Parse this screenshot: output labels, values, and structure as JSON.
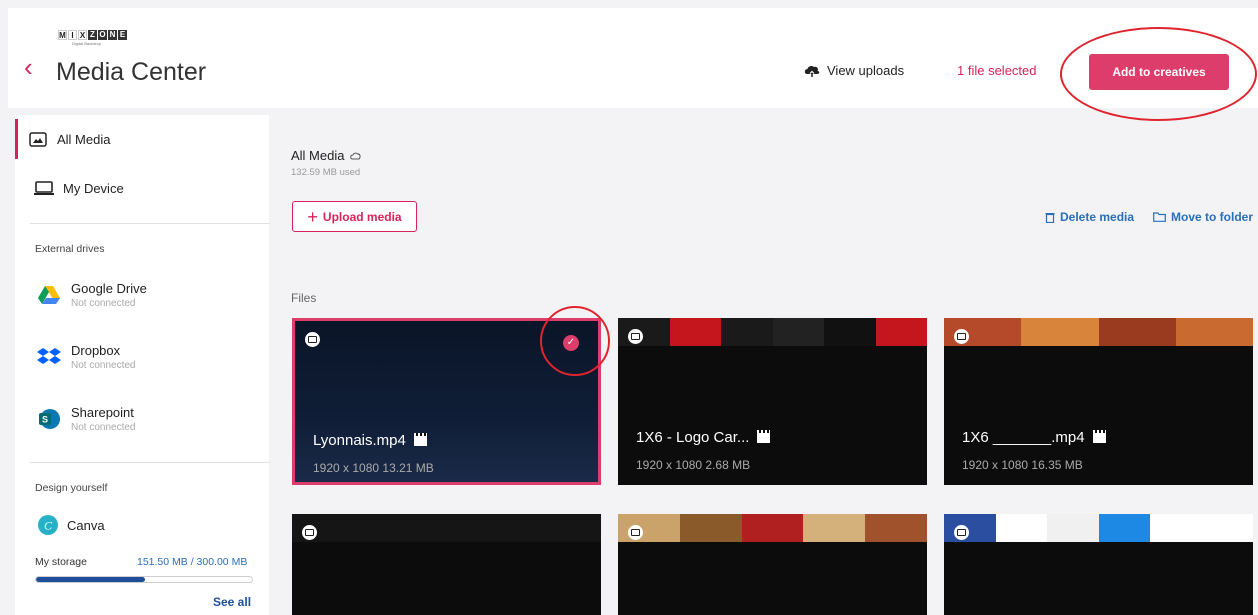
{
  "header": {
    "logo_letters_left": [
      "M",
      "I",
      "X"
    ],
    "logo_letters_right": [
      "Z",
      "O",
      "N",
      "E"
    ],
    "logo_sub": "Digital Backdrop",
    "title": "Media Center",
    "view_uploads": "View uploads",
    "file_selected": "1 file selected",
    "add_button": "Add to creatives"
  },
  "sidebar": {
    "all_media": "All Media",
    "my_device": "My Device",
    "external_drives": "External drives",
    "google_drive": {
      "label": "Google Drive",
      "status": "Not connected"
    },
    "dropbox": {
      "label": "Dropbox",
      "status": "Not connected"
    },
    "sharepoint": {
      "label": "Sharepoint",
      "status": "Not connected"
    },
    "design_yourself": "Design yourself",
    "canva": "Canva",
    "storage_label": "My storage",
    "storage_value": "151.50 MB / 300.00 MB",
    "storage_fraction": 0.505,
    "see_all": "See all"
  },
  "main": {
    "title": "All Media",
    "used": "132.59 MB used",
    "upload_button": "Upload media",
    "delete_media": "Delete media",
    "move_to_folder": "Move to folder",
    "files_label": "Files"
  },
  "cards": [
    {
      "name": "Lyonnais.mp4",
      "meta": "1920 x 1080  13.21 MB",
      "selected": true
    },
    {
      "name": "1X6 - Logo Car...",
      "meta": "1920 x 1080  2.68 MB",
      "selected": false
    },
    {
      "name": "1X6 _______.mp4",
      "meta": "1920 x 1080  16.35 MB",
      "selected": false
    },
    {
      "name": "",
      "meta": "",
      "selected": false
    },
    {
      "name": "",
      "meta": "",
      "selected": false
    },
    {
      "name": "",
      "meta": "",
      "selected": false
    }
  ],
  "colors": {
    "accent": "#dc3d6a",
    "link": "#2a6fb8",
    "annotation": "#e0242e"
  },
  "icons": {
    "back": "chevron-left-icon",
    "upload_cloud": "cloud-upload-icon",
    "check": "check-icon",
    "device": "device-icon"
  }
}
